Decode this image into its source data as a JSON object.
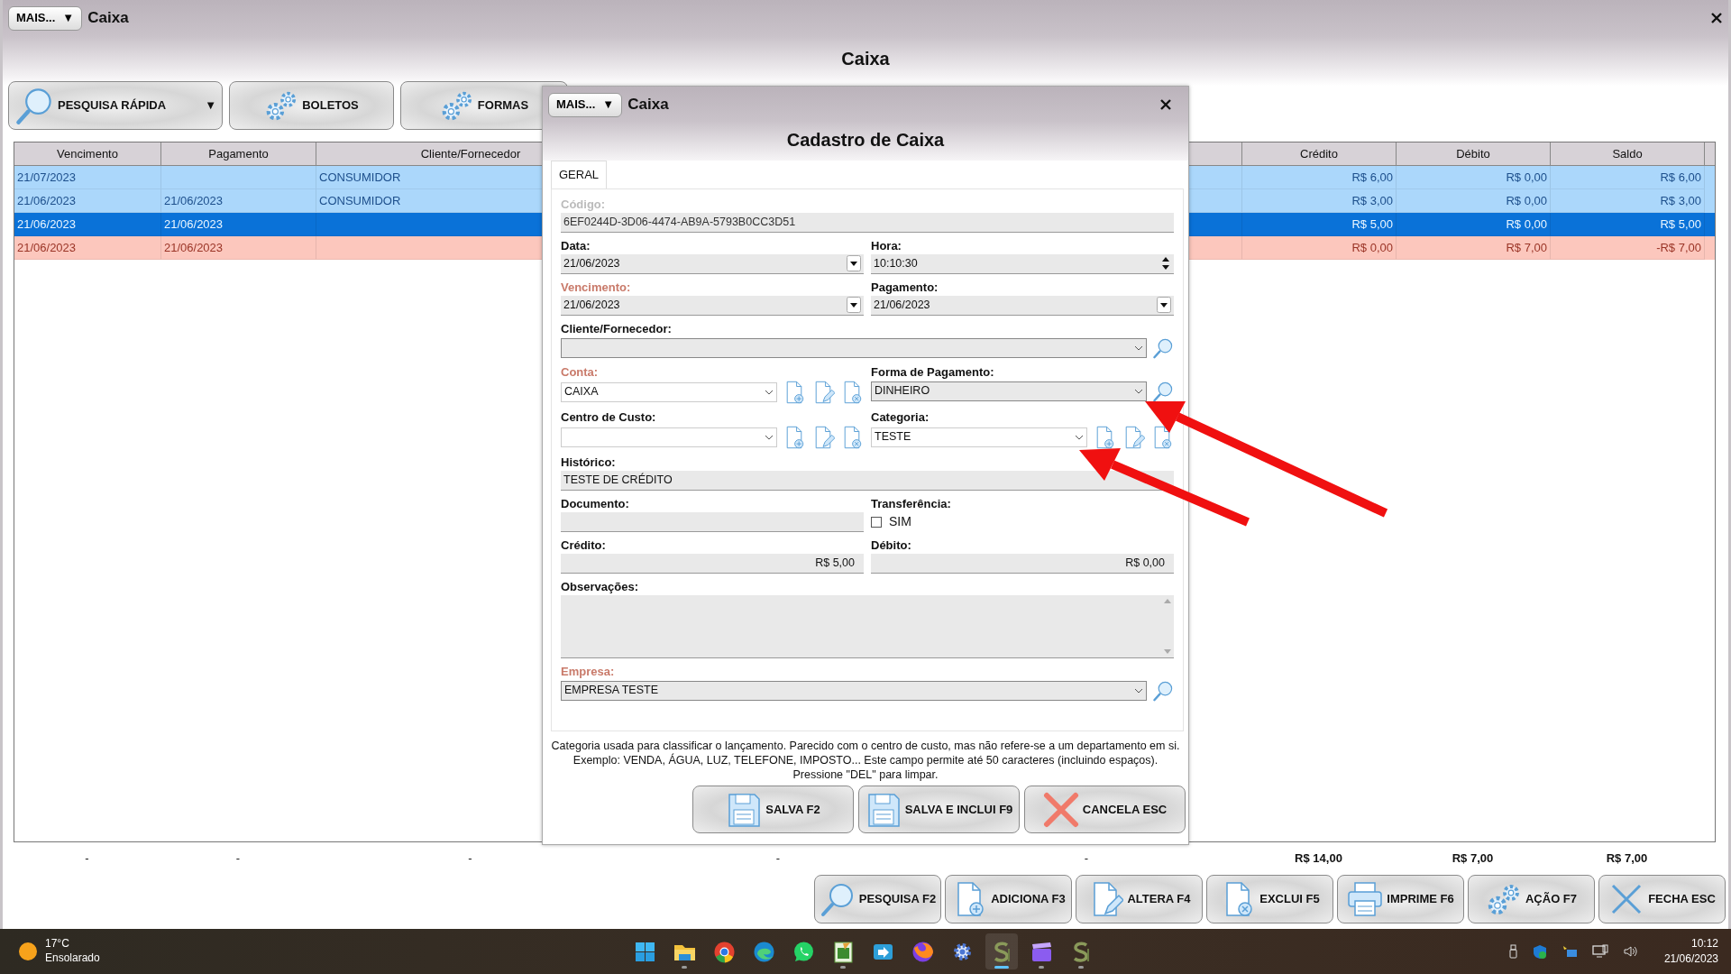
{
  "window": {
    "menu_button": "MAIS...",
    "menu_caret": "▼",
    "title": "Caixa"
  },
  "header": "Caixa",
  "toolbar": [
    {
      "label": "PESQUISA RÁPIDA",
      "caret": "▼"
    },
    {
      "label": "BOLETOS"
    },
    {
      "label": "FORMAS"
    }
  ],
  "table": {
    "columns": [
      {
        "label": "Vencimento"
      },
      {
        "label": "Pagamento"
      },
      {
        "label": "Cliente/Fornecedor"
      },
      {},
      {},
      {
        "label": "Crédito"
      },
      {
        "label": "Débito"
      },
      {
        "label": "Saldo"
      }
    ],
    "rows": [
      {
        "kind": "credit",
        "selected": false,
        "cells": [
          "21/07/2023",
          null,
          "CONSUMIDOR",
          null,
          null,
          "R$ 6,00",
          "R$ 0,00",
          "R$ 6,00"
        ]
      },
      {
        "kind": "credit",
        "selected": false,
        "cells": [
          "21/06/2023",
          "21/06/2023",
          "CONSUMIDOR",
          null,
          null,
          "R$ 3,00",
          "R$ 0,00",
          "R$ 3,00"
        ]
      },
      {
        "kind": "credit",
        "selected": true,
        "cells": [
          "21/06/2023",
          "21/06/2023",
          null,
          null,
          null,
          "R$ 5,00",
          "R$ 0,00",
          "R$ 5,00"
        ]
      },
      {
        "kind": "debit",
        "selected": false,
        "cells": [
          "21/06/2023",
          "21/06/2023",
          null,
          null,
          null,
          "R$ 0,00",
          "R$ 7,00",
          "-R$ 7,00"
        ]
      }
    ],
    "totals": [
      "-",
      "-",
      "-",
      "-",
      "-",
      "R$ 14,00",
      "R$ 7,00",
      "R$ 7,00"
    ]
  },
  "actions": [
    {
      "label": "PESQUISA F2"
    },
    {
      "label": "ADICIONA F3"
    },
    {
      "label": "ALTERA F4"
    },
    {
      "label": "EXCLUI F5"
    },
    {
      "label": "IMPRIME F6"
    },
    {
      "label": "AÇÃO F7"
    },
    {
      "label": "FECHA ESC"
    }
  ],
  "dialog": {
    "menu_button": "MAIS...",
    "menu_caret": "▼",
    "title": "Caixa",
    "heading": "Cadastro de Caixa",
    "tabs": [
      {
        "label": "GERAL",
        "selected": true
      }
    ],
    "rows": [
      {
        "fields": [
          {
            "kind": "text",
            "label": "Código:",
            "disabled": true,
            "value": "6EF0244D-3D06-4474-AB9A-5793B0CC3D51"
          }
        ]
      },
      {
        "fields": [
          {
            "kind": "date",
            "label": "Data:",
            "value": "21/06/2023"
          },
          {
            "kind": "time",
            "label": "Hora:",
            "value": "10:10:30"
          }
        ]
      },
      {
        "fields": [
          {
            "kind": "date",
            "label": "Vencimento:",
            "required": true,
            "value": "21/06/2023"
          },
          {
            "kind": "date",
            "label": "Pagamento:",
            "value": "21/06/2023"
          }
        ]
      },
      {
        "fields": [
          {
            "kind": "lookup",
            "label": "Cliente/Fornecedor:"
          }
        ]
      },
      {
        "fields": [
          {
            "kind": "crud",
            "label": "Conta:",
            "required": true,
            "value": "CAIXA"
          },
          {
            "kind": "lookup",
            "label": "Forma de Pagamento:",
            "value": "DINHEIRO"
          }
        ]
      },
      {
        "fields": [
          {
            "kind": "crud",
            "label": "Centro de Custo:"
          },
          {
            "kind": "crud",
            "label": "Categoria:",
            "value": "TESTE"
          }
        ]
      },
      {
        "fields": [
          {
            "kind": "text",
            "label": "Histórico:",
            "value": "TESTE DE CRÉDITO"
          }
        ]
      },
      {
        "fields": [
          {
            "kind": "text",
            "label": "Documento:"
          },
          {
            "kind": "check",
            "label": "Transferência:",
            "option": "SIM",
            "checked": false
          }
        ]
      },
      {
        "fields": [
          {
            "kind": "money",
            "label": "Crédito:",
            "value": "R$ 5,00"
          },
          {
            "kind": "money",
            "label": "Débito:",
            "value": "R$ 0,00"
          }
        ]
      },
      {
        "fields": [
          {
            "kind": "memo",
            "label": "Observações:"
          }
        ]
      },
      {
        "fields": [
          {
            "kind": "lookup",
            "label": "Empresa:",
            "required": true,
            "value": "EMPRESA TESTE"
          }
        ]
      }
    ],
    "help": "Categoria usada para classificar o lançamento. Parecido com o centro de custo, mas não refere-se a um departamento em si. Exemplo: VENDA, ÁGUA, LUZ, TELEFONE, IMPOSTO... Este campo permite até 50 caracteres (incluindo espaços). Pressione \"DEL\" para limpar.",
    "buttons": [
      {
        "label": "SALVA F2"
      },
      {
        "label": "SALVA E INCLUI F9"
      },
      {
        "label": "CANCELA ESC"
      }
    ]
  },
  "taskbar": {
    "temperature": "17°C",
    "condition": "Ensolarado",
    "apps": [
      {
        "running": false,
        "active": false
      },
      {
        "running": true,
        "active": false
      },
      {
        "running": false,
        "active": false
      },
      {
        "running": false,
        "active": false
      },
      {
        "running": false,
        "active": false
      },
      {
        "running": true,
        "active": false
      },
      {
        "running": false,
        "active": false
      },
      {
        "running": false,
        "active": false
      },
      {
        "running": false,
        "active": false
      },
      {
        "running": true,
        "active": true
      },
      {
        "running": true,
        "active": false
      },
      {
        "running": true,
        "active": false
      }
    ],
    "time": "10:12",
    "date": "21/06/2023"
  }
}
